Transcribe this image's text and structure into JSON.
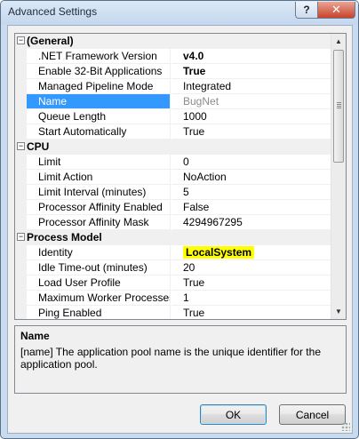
{
  "window": {
    "title": "Advanced Settings",
    "help_label": "?",
    "close_label": "✕"
  },
  "grid": {
    "sections": [
      {
        "name": "(General)",
        "toggle": "−",
        "rows": [
          {
            "name": ".NET Framework Version",
            "value": "v4.0",
            "bold": true
          },
          {
            "name": "Enable 32-Bit Applications",
            "value": "True",
            "bold": true
          },
          {
            "name": "Managed Pipeline Mode",
            "value": "Integrated"
          },
          {
            "name": "Name",
            "value": "BugNet",
            "selected": true,
            "muted": true
          },
          {
            "name": "Queue Length",
            "value": "1000"
          },
          {
            "name": "Start Automatically",
            "value": "True"
          }
        ]
      },
      {
        "name": "CPU",
        "toggle": "−",
        "rows": [
          {
            "name": "Limit",
            "value": "0"
          },
          {
            "name": "Limit Action",
            "value": "NoAction"
          },
          {
            "name": "Limit Interval (minutes)",
            "value": "5"
          },
          {
            "name": "Processor Affinity Enabled",
            "value": "False"
          },
          {
            "name": "Processor Affinity Mask",
            "value": "4294967295"
          }
        ]
      },
      {
        "name": "Process Model",
        "toggle": "−",
        "rows": [
          {
            "name": "Identity",
            "value": "LocalSystem",
            "highlight": true
          },
          {
            "name": "Idle Time-out (minutes)",
            "value": "20"
          },
          {
            "name": "Load User Profile",
            "value": "True"
          },
          {
            "name": "Maximum Worker Processes",
            "value": "1"
          },
          {
            "name": "Ping Enabled",
            "value": "True"
          }
        ]
      }
    ],
    "scroll_up": "▲",
    "scroll_down": "▼"
  },
  "description": {
    "title": "Name",
    "text": "[name] The application pool name is the unique identifier for the application pool."
  },
  "buttons": {
    "ok": "OK",
    "cancel": "Cancel"
  },
  "colors": {
    "selection": "#3399ff",
    "highlight": "#ffff00"
  }
}
